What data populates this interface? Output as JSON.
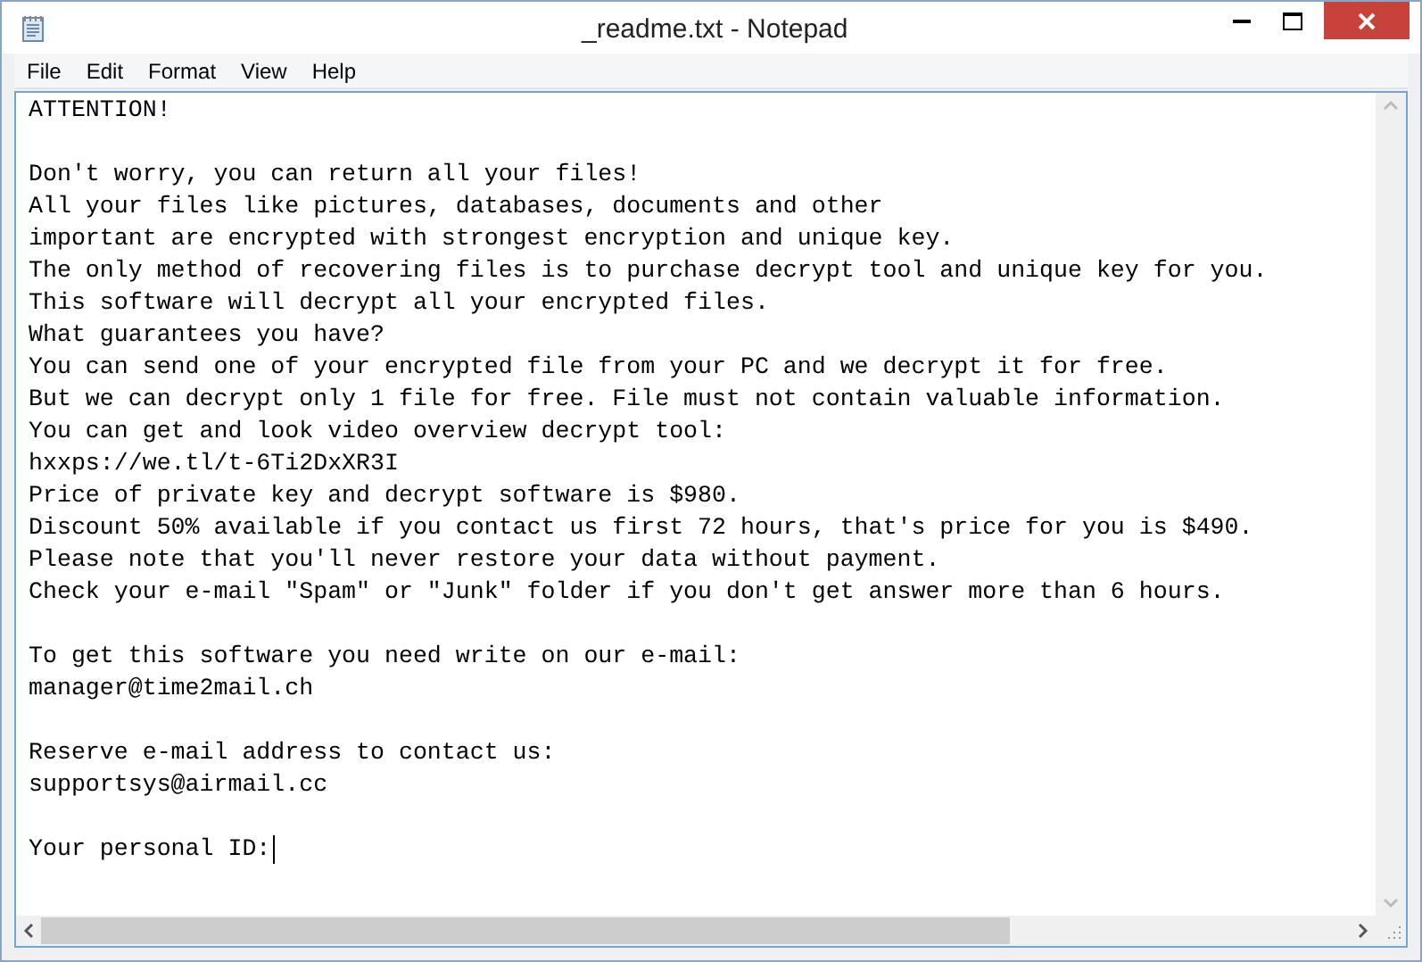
{
  "window": {
    "title": "_readme.txt - Notepad"
  },
  "menu": [
    "File",
    "Edit",
    "Format",
    "View",
    "Help"
  ],
  "document": {
    "blocks": [
      [
        "ATTENTION!"
      ],
      [
        "Don't worry, you can return all your files!",
        "All your files like pictures, databases, documents and other",
        "important are encrypted with strongest encryption and unique key.",
        "The only method of recovering files is to purchase decrypt tool and unique key for you.",
        "This software will decrypt all your encrypted files.",
        "What guarantees you have?",
        "You can send one of your encrypted file from your PC and we decrypt it for free.",
        "But we can decrypt only 1 file for free. File must not contain valuable information.",
        "You can get and look video overview decrypt tool:",
        "hxxps://we.tl/t-6Ti2DxXR3I",
        "Price of private key and decrypt software is $980.",
        "Discount 50% available if you contact us first 72 hours, that's price for you is $490.",
        "Please note that you'll never restore your data without payment.",
        "Check your e-mail \"Spam\" or \"Junk\" folder if you don't get answer more than 6 hours."
      ],
      [
        "To get this software you need write on our e-mail:",
        "manager@time2mail.ch"
      ],
      [
        "Reserve e-mail address to contact us:",
        "supportsys@airmail.cc"
      ],
      [
        "Your personal ID:"
      ]
    ]
  }
}
